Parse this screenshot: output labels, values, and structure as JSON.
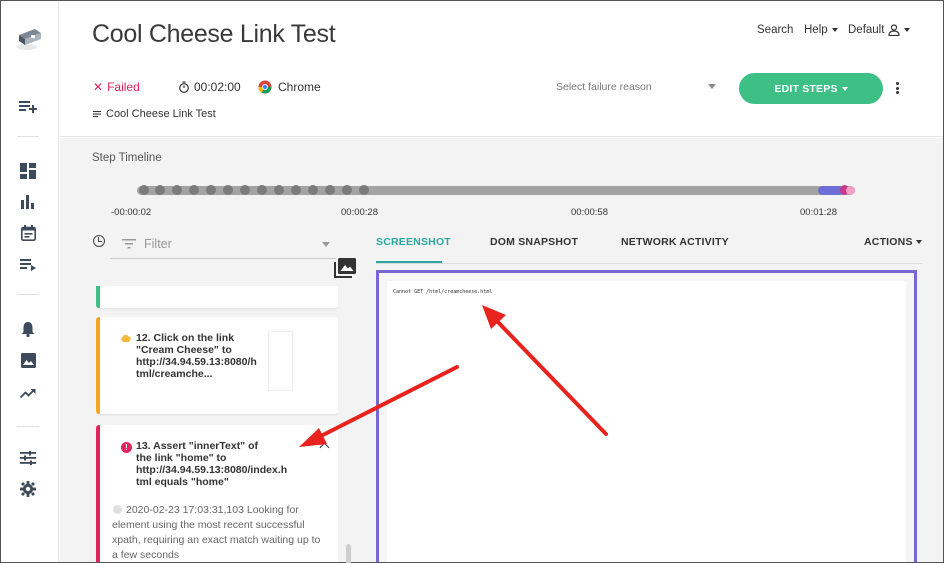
{
  "app": {
    "title": "Cool Cheese Link Test",
    "nav": {
      "search": "Search",
      "help": "Help",
      "profile": "Default"
    }
  },
  "sidebar": {
    "items": [
      {
        "icon": "add-list-icon"
      },
      {
        "icon": "dashboard-icon"
      },
      {
        "icon": "bar-chart-icon"
      },
      {
        "icon": "calendar-icon"
      },
      {
        "icon": "playlist-icon"
      },
      {
        "icon": "bell-icon"
      },
      {
        "icon": "image-icon"
      },
      {
        "icon": "trending-icon"
      },
      {
        "icon": "tune-icon"
      },
      {
        "icon": "gear-icon"
      }
    ]
  },
  "run": {
    "status": "Failed",
    "duration": "00:02:00",
    "browser": "Chrome",
    "test_name": "Cool Cheese Link Test",
    "failure_placeholder": "Select failure reason",
    "edit_steps_label": "EDIT STEPS"
  },
  "timeline": {
    "label": "Step Timeline",
    "ticks": [
      "-00:00:02",
      "00:00:28",
      "00:00:58",
      "00:01:28"
    ]
  },
  "filter": {
    "placeholder": "Filter"
  },
  "steps": [
    {
      "number": "12.",
      "title": "12. Click on the link \"Cream Cheese\" to http://34.94.59.13:8080/h tml/creamche...",
      "status": "warning"
    },
    {
      "number": "13.",
      "title": "13. Assert \"innerText\" of the link \"home\" to http://34.94.59.13:8080/index.h tml equals \"home\"",
      "status": "failed",
      "log": "2020-02-23 17:03:31,103 Looking for element using the most recent successful xpath, requiring an exact match waiting up to a few seconds"
    }
  ],
  "tabs": {
    "screenshot": "SCREENSHOT",
    "dom": "DOM SNAPSHOT",
    "network": "NETWORK ACTIVITY",
    "actions": "ACTIONS"
  },
  "screenshot": {
    "text": "Cannot GET /html/creamcheese.html"
  },
  "colors": {
    "accent": "#2aa8a0",
    "edit_button": "#3dbf86",
    "failed": "#e0245e",
    "warning": "#f5a623",
    "screenshot_border": "#7668d0",
    "annotation_arrow": "#e8231d"
  }
}
